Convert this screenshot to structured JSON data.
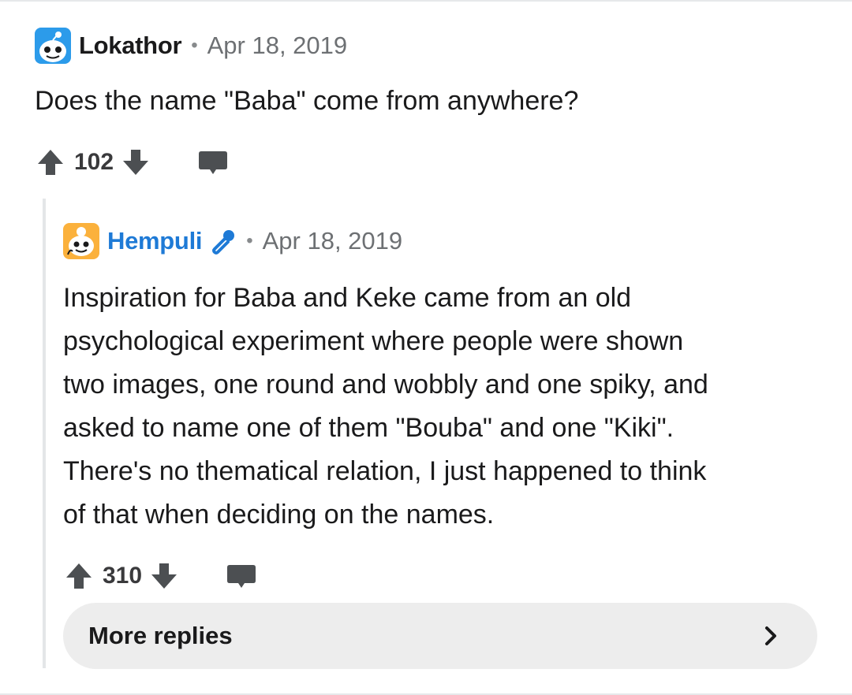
{
  "comment": {
    "author": "Lokathor",
    "separator": "•",
    "timestamp": "Apr 18, 2019",
    "body": "Does the name \"Baba\" come from anywhere?",
    "score": "102",
    "avatar_icon": "snoo-avatar-blue-icon",
    "upvote_icon": "upvote-arrow-icon",
    "downvote_icon": "downvote-arrow-icon",
    "reply_icon": "speech-bubble-icon"
  },
  "reply": {
    "author": "Hempuli",
    "flair_icon": "microphone-icon",
    "separator": "•",
    "timestamp": "Apr 18, 2019",
    "body_lines": [
      "Inspiration for Baba and Keke came from an old",
      "psychological experiment where people were shown",
      "two images, one round and wobbly and one spiky, and",
      "asked to name one of them \"Bouba\" and one \"Kiki\".",
      "There's no thematical relation, I just happened to think",
      "of that when deciding on the names."
    ],
    "score": "310",
    "avatar_icon": "snoo-avatar-orange-icon",
    "upvote_icon": "upvote-arrow-icon",
    "downvote_icon": "downvote-arrow-icon",
    "reply_icon": "speech-bubble-icon"
  },
  "more_replies": {
    "label": "More replies",
    "chevron_icon": "chevron-right-icon"
  },
  "colors": {
    "mod_username": "#1e7ad6",
    "icon_gray": "#4c4f52",
    "pill_background": "#ededed"
  }
}
